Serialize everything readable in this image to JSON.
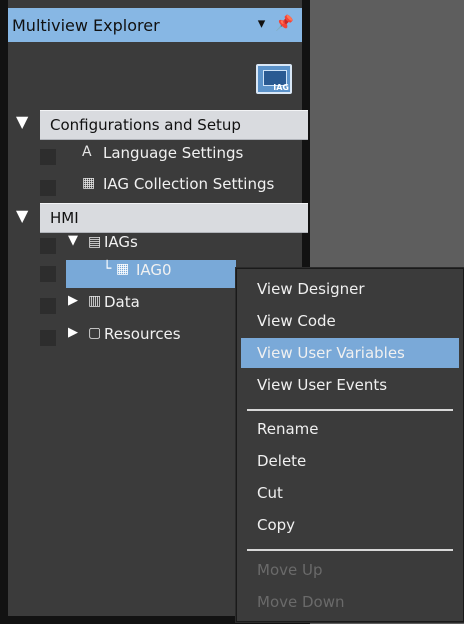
{
  "panel": {
    "title": "Multiview Explorer",
    "pin_icon": "pin-icon",
    "dropdown_icon": "chevron-down-icon",
    "toolbar_icon_label": "IAG"
  },
  "tree": {
    "sections": [
      {
        "label": "Configurations and Setup",
        "items": [
          {
            "label": "Language Settings",
            "icon": "language-icon"
          },
          {
            "label": "IAG Collection Settings",
            "icon": "collection-icon"
          }
        ]
      },
      {
        "label": "HMI",
        "items": [
          {
            "label": "IAGs",
            "icon": "folder-icon",
            "expanded": true
          },
          {
            "label": "IAG0",
            "icon": "iag-icon",
            "selected": true
          },
          {
            "label": "Data",
            "icon": "data-icon",
            "expanded": false
          },
          {
            "label": "Resources",
            "icon": "resources-icon",
            "expanded": false
          }
        ]
      }
    ]
  },
  "context_menu": {
    "items": [
      {
        "label": "View Designer",
        "enabled": true
      },
      {
        "label": "View Code",
        "enabled": true
      },
      {
        "label": "View User Variables",
        "enabled": true,
        "highlighted": true
      },
      {
        "label": "View User Events",
        "enabled": true
      },
      {
        "label": "Rename",
        "enabled": true
      },
      {
        "label": "Delete",
        "enabled": true
      },
      {
        "label": "Cut",
        "enabled": true
      },
      {
        "label": "Copy",
        "enabled": true
      },
      {
        "label": "Move Up",
        "enabled": false
      },
      {
        "label": "Move Down",
        "enabled": false
      }
    ]
  }
}
